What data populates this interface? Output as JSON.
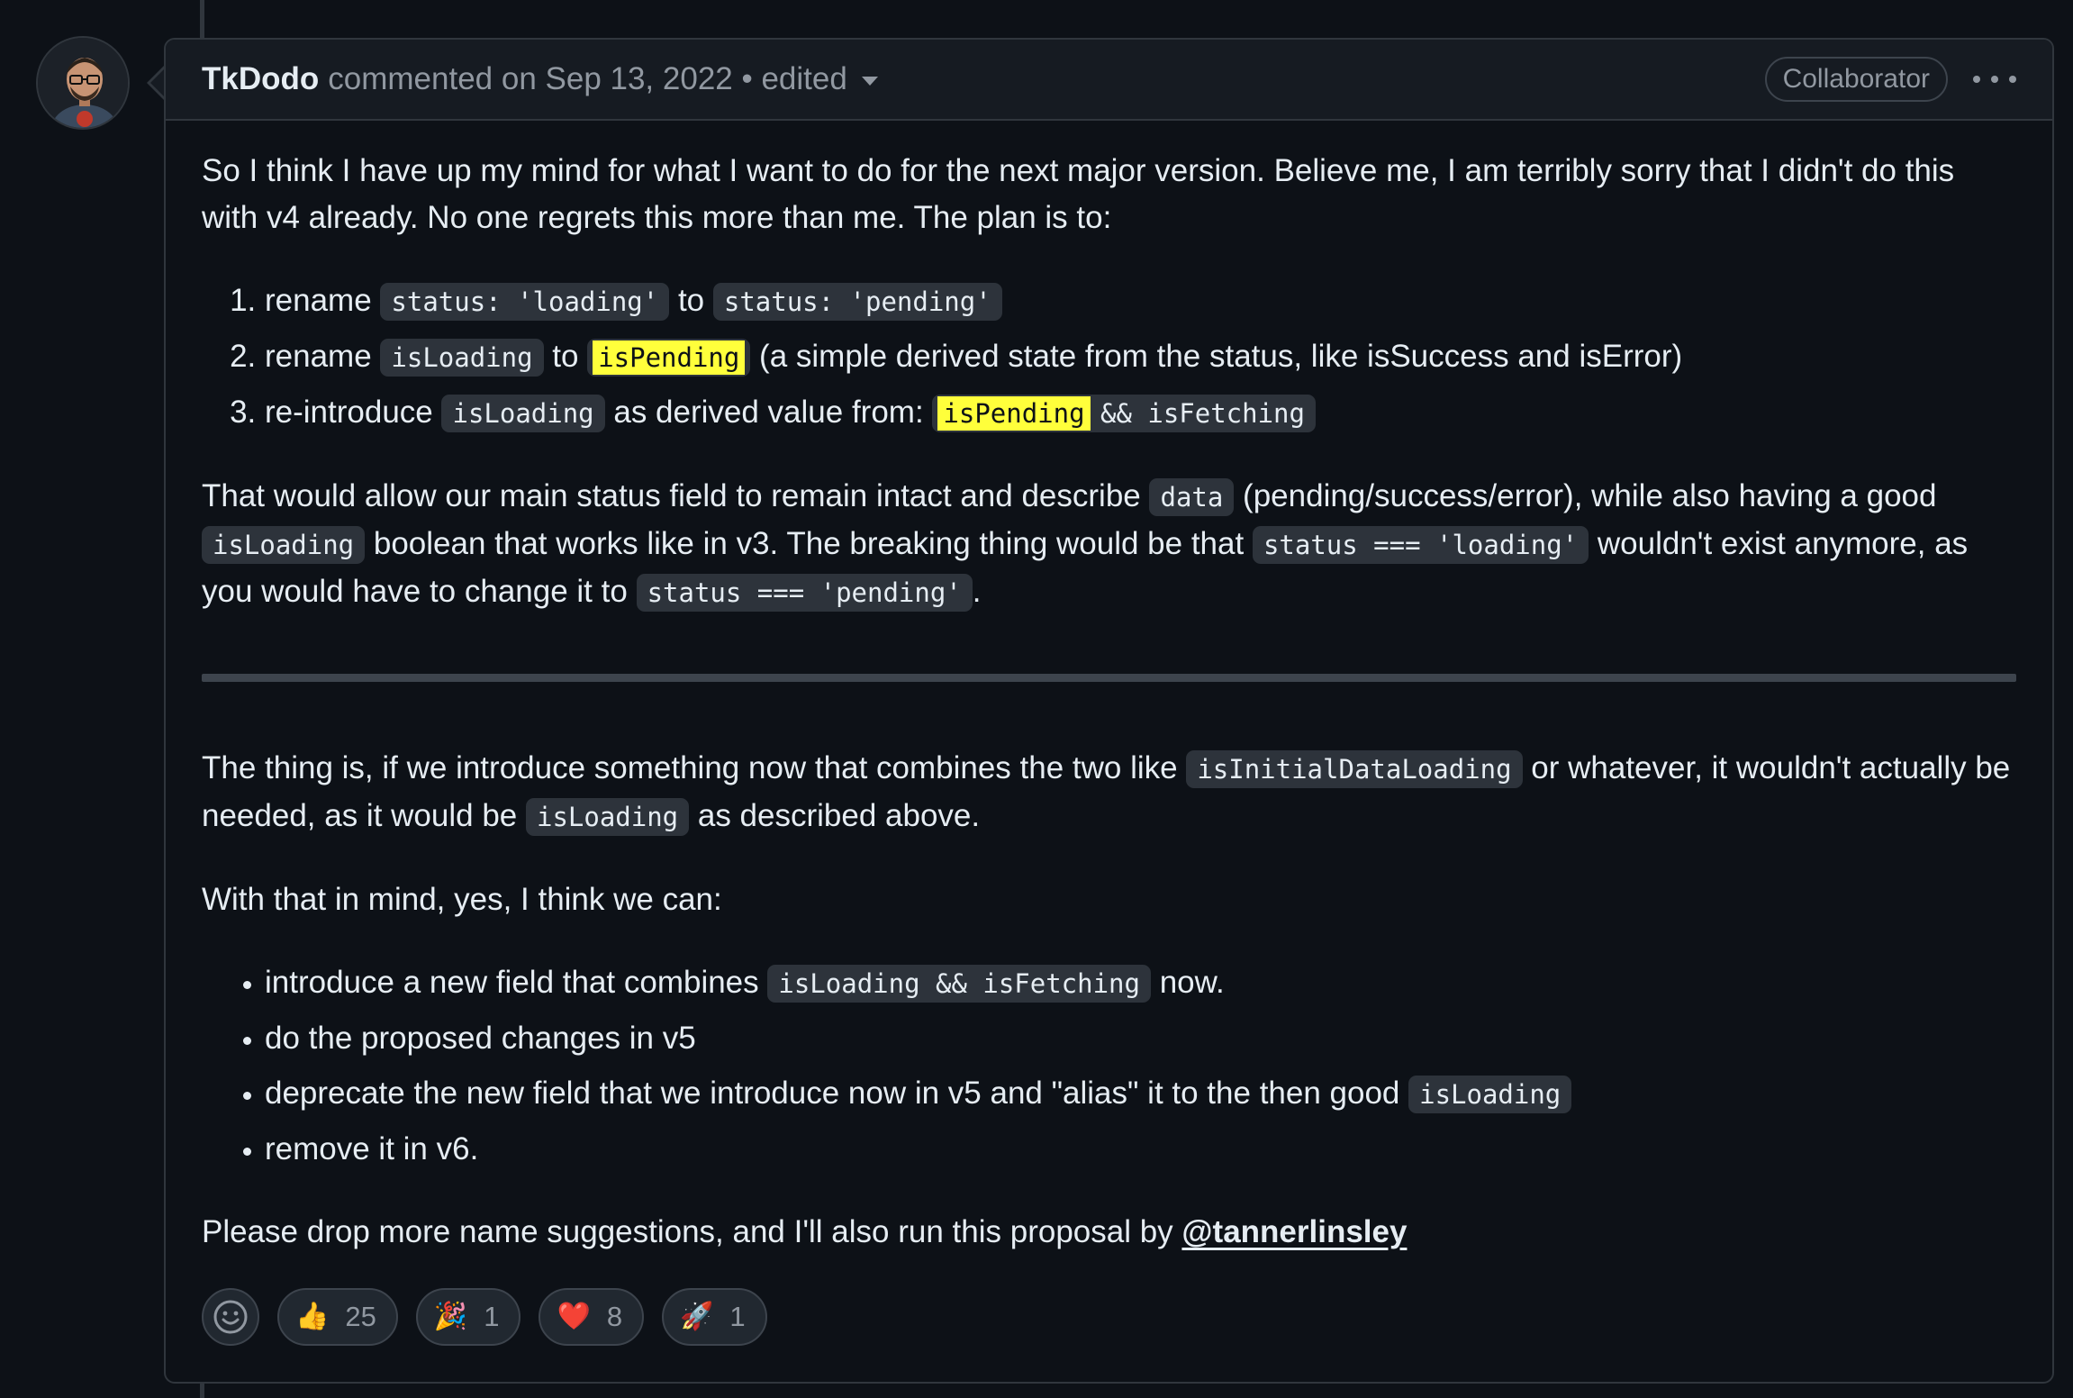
{
  "comment": {
    "author": "TkDodo",
    "meta": "commented on Sep 13, 2022 • edited",
    "role": "Collaborator",
    "intro": "So I think I have up my mind for what I want to do for the next major version. Believe me, I am terribly sorry that I didn't do this with v4 already. No one regrets this more than me. The plan is to:",
    "plan": [
      {
        "t1": "rename ",
        "c1": "status: 'loading'",
        "t2": " to ",
        "c2": "status: 'pending'",
        "t3": ""
      },
      {
        "t1": "rename ",
        "c1": "isLoading",
        "t2": " to ",
        "c2": "isPending",
        "t3": " (a simple derived state from the status, like isSuccess and isError)"
      },
      {
        "t1": "re-introduce ",
        "c1": "isLoading",
        "t2": " as derived value from: ",
        "c2a": "isPending",
        "c2b": " && isFetching"
      }
    ],
    "para2": {
      "t1": "That would allow our main status field to remain intact and describe ",
      "c1": "data",
      "t2": " (pending/success/error), while also having a good ",
      "c2": "isLoading",
      "t3": " boolean that works like in v3. The breaking thing would be that ",
      "c3": "status === 'loading'",
      "t4": " wouldn't exist anymore, as you would have to change it to ",
      "c4": "status === 'pending'",
      "t5": "."
    },
    "para3": {
      "t1": "The thing is, if we introduce something now that combines the two like ",
      "c1": "isInitialDataLoading",
      "t2": " or whatever, it wouldn't actually be needed, as it would be ",
      "c2": "isLoading",
      "t3": " as described above."
    },
    "para4": "With that in mind, yes, I think we can:",
    "bullets": {
      "b1_t1": "introduce a new field that combines ",
      "b1_c1": "isLoading && isFetching",
      "b1_t2": " now.",
      "b2": "do the proposed changes in v5",
      "b3_t1": "deprecate the new field that we introduce now in v5 and \"alias\" it to the then good ",
      "b3_c1": "isLoading",
      "b4": "remove it in v6."
    },
    "para5": {
      "t1": "Please drop more name suggestions, and I'll also run this proposal by ",
      "mention": "@tannerlinsley"
    },
    "reactions": [
      {
        "emoji": "👍",
        "count": "25"
      },
      {
        "emoji": "🎉",
        "count": "1"
      },
      {
        "emoji": "❤️",
        "count": "8"
      },
      {
        "emoji": "🚀",
        "count": "1"
      }
    ]
  },
  "icons": {
    "add_reaction": "smiley-icon",
    "menu": "kebab-horizontal-icon",
    "edited_dropdown": "triangle-down-icon"
  },
  "colors": {
    "background": "#0d1117",
    "header_bg": "#161b22",
    "border": "#30363d",
    "code_bg": "#2d333b",
    "highlight": "#ffff3b",
    "muted_text": "#9198a1",
    "text": "#e6edf3"
  }
}
